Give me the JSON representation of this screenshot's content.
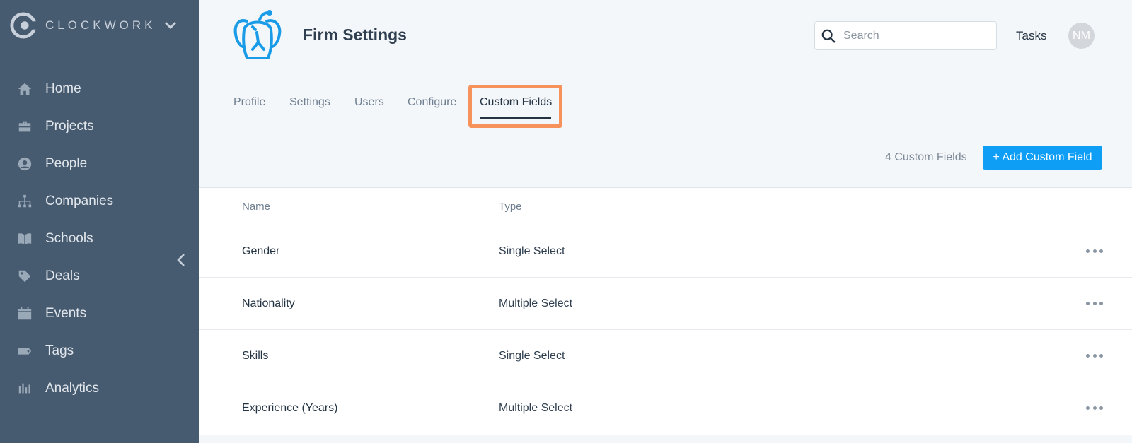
{
  "brand": {
    "name": "CLOCKWORK"
  },
  "sidebar": {
    "items": [
      {
        "label": "Home",
        "icon": "home-icon"
      },
      {
        "label": "Projects",
        "icon": "briefcase-icon"
      },
      {
        "label": "People",
        "icon": "person-icon"
      },
      {
        "label": "Companies",
        "icon": "org-chart-icon"
      },
      {
        "label": "Schools",
        "icon": "book-icon"
      },
      {
        "label": "Deals",
        "icon": "price-tag-icon"
      },
      {
        "label": "Events",
        "icon": "calendar-icon"
      },
      {
        "label": "Tags",
        "icon": "tag-icon"
      },
      {
        "label": "Analytics",
        "icon": "bar-chart-icon"
      }
    ]
  },
  "header": {
    "title": "Firm Settings",
    "search_placeholder": "Search",
    "tasks_label": "Tasks",
    "avatar_initials": "NM"
  },
  "tabs": [
    {
      "label": "Profile"
    },
    {
      "label": "Settings"
    },
    {
      "label": "Users"
    },
    {
      "label": "Configure"
    },
    {
      "label": "Custom Fields",
      "active": true
    }
  ],
  "toolbar": {
    "count_text": "4 Custom Fields",
    "add_label": "+ Add Custom Field"
  },
  "table": {
    "columns": [
      "Name",
      "Type"
    ],
    "rows": [
      {
        "name": "Gender",
        "type": "Single Select"
      },
      {
        "name": "Nationality",
        "type": "Multiple Select"
      },
      {
        "name": "Skills",
        "type": "Single Select"
      },
      {
        "name": "Experience (Years)",
        "type": "Multiple Select"
      }
    ]
  },
  "colors": {
    "sidebar_bg": "#475b70",
    "accent": "#0e9ef5",
    "highlight": "#f7935a"
  }
}
